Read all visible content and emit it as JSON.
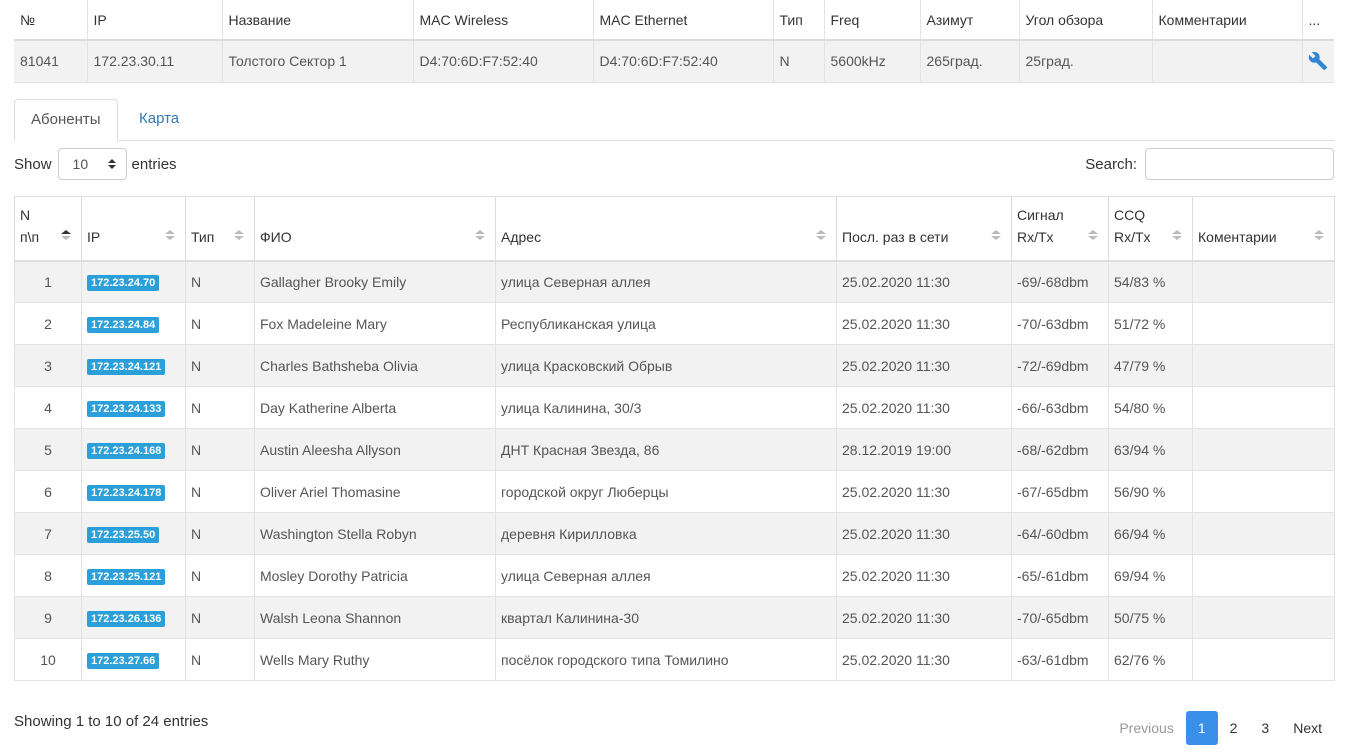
{
  "sector": {
    "headers": [
      "№",
      "IP",
      "Название",
      "MAC Wireless",
      "MAC Ethernet",
      "Тип",
      "Freq",
      "Азимут",
      "Угол обзора",
      "Комментарии",
      "..."
    ],
    "row": {
      "num": "81041",
      "ip": "172.23.30.11",
      "name": "Толстого Сектор 1",
      "mac_wireless": "D4:70:6D:F7:52:40",
      "mac_ethernet": "D4:70:6D:F7:52:40",
      "type": "N",
      "freq": "5600kHz",
      "azimuth": "265град.",
      "angle": "25град.",
      "comments": ""
    },
    "edit_icon": "wrench-icon",
    "edit_icon_color": "#2d86d6"
  },
  "tabs": [
    {
      "label": "Абоненты",
      "active": true
    },
    {
      "label": "Карта",
      "active": false
    }
  ],
  "length": {
    "show": "Show",
    "value": "10",
    "entries": "entries"
  },
  "search": {
    "label": "Search:",
    "value": ""
  },
  "subscribers": {
    "headers": {
      "num_line1": "N",
      "num_line2": "п\\п",
      "ip": "IP",
      "type": "Тип",
      "fio": "ФИО",
      "address": "Адрес",
      "last_seen": "Посл. раз в сети",
      "signal_line1": "Сигнал",
      "signal_line2": "Rx/Tx",
      "ccq_line1": "CCQ",
      "ccq_line2": "Rx/Tx",
      "comments": "Коментарии"
    },
    "badge_color": "#2b9fd9",
    "rows": [
      {
        "num": "1",
        "ip": "172.23.24.70",
        "type": "N",
        "fio": "Gallagher Brooky Emily",
        "address": "улица Северная аллея",
        "last_seen": "25.02.2020 11:30",
        "signal": "-69/-68dbm",
        "ccq": "54/83 %",
        "comment": ""
      },
      {
        "num": "2",
        "ip": "172.23.24.84",
        "type": "N",
        "fio": "Fox Madeleine Mary",
        "address": "Республиканская улица",
        "last_seen": "25.02.2020 11:30",
        "signal": "-70/-63dbm",
        "ccq": "51/72 %",
        "comment": ""
      },
      {
        "num": "3",
        "ip": "172.23.24.121",
        "type": "N",
        "fio": "Charles Bathsheba Olivia",
        "address": "улица Красковский Обрыв",
        "last_seen": "25.02.2020 11:30",
        "signal": "-72/-69dbm",
        "ccq": "47/79 %",
        "comment": ""
      },
      {
        "num": "4",
        "ip": "172.23.24.133",
        "type": "N",
        "fio": "Day Katherine Alberta",
        "address": "улица Калинина, 30/3",
        "last_seen": "25.02.2020 11:30",
        "signal": "-66/-63dbm",
        "ccq": "54/80 %",
        "comment": ""
      },
      {
        "num": "5",
        "ip": "172.23.24.168",
        "type": "N",
        "fio": "Austin Aleesha Allyson",
        "address": "ДНТ Красная Звезда, 86",
        "last_seen": "28.12.2019 19:00",
        "signal": "-68/-62dbm",
        "ccq": "63/94 %",
        "comment": ""
      },
      {
        "num": "6",
        "ip": "172.23.24.178",
        "type": "N",
        "fio": "Oliver Ariel Thomasine",
        "address": "городской округ Люберцы",
        "last_seen": "25.02.2020 11:30",
        "signal": "-67/-65dbm",
        "ccq": "56/90 %",
        "comment": ""
      },
      {
        "num": "7",
        "ip": "172.23.25.50",
        "type": "N",
        "fio": "Washington Stella Robyn",
        "address": "деревня Кирилловка",
        "last_seen": "25.02.2020 11:30",
        "signal": "-64/-60dbm",
        "ccq": "66/94 %",
        "comment": ""
      },
      {
        "num": "8",
        "ip": "172.23.25.121",
        "type": "N",
        "fio": "Mosley Dorothy Patricia",
        "address": "улица Северная аллея",
        "last_seen": "25.02.2020 11:30",
        "signal": "-65/-61dbm",
        "ccq": "69/94 %",
        "comment": ""
      },
      {
        "num": "9",
        "ip": "172.23.26.136",
        "type": "N",
        "fio": "Walsh Leona Shannon",
        "address": "квартал Калинина-30",
        "last_seen": "25.02.2020 11:30",
        "signal": "-70/-65dbm",
        "ccq": "50/75 %",
        "comment": ""
      },
      {
        "num": "10",
        "ip": "172.23.27.66",
        "type": "N",
        "fio": "Wells Mary Ruthy",
        "address": "посёлок городского типа Томилино",
        "last_seen": "25.02.2020 11:30",
        "signal": "-63/-61dbm",
        "ccq": "62/76 %",
        "comment": ""
      }
    ]
  },
  "info": "Showing 1 to 10 of 24 entries",
  "pagination": {
    "previous": "Previous",
    "pages": [
      "1",
      "2",
      "3"
    ],
    "current": "1",
    "next": "Next",
    "active_color": "#3a8fe8"
  }
}
